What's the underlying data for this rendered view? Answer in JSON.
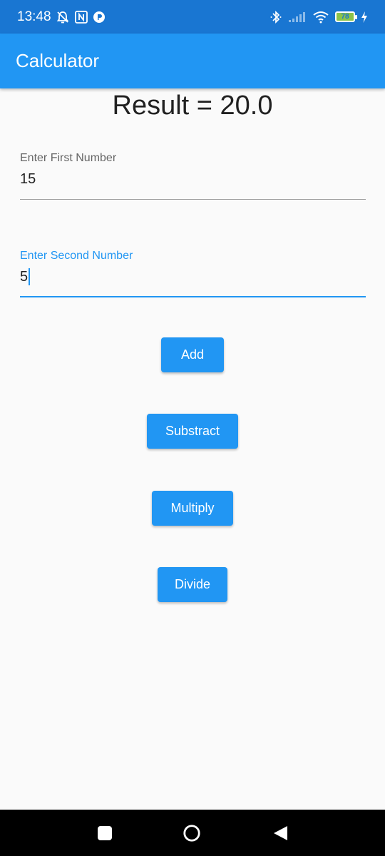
{
  "status_bar": {
    "time": "13:48",
    "battery": "78",
    "icons": [
      "mute-bell-icon",
      "nfc-icon",
      "app-notification-icon",
      "bluetooth-icon",
      "signal-icon",
      "wifi-icon",
      "battery-icon",
      "charging-icon"
    ]
  },
  "app_bar": {
    "title": "Calculator"
  },
  "result": {
    "text": "Result = 20.0"
  },
  "inputs": {
    "first": {
      "label": "Enter First Number",
      "value": "15"
    },
    "second": {
      "label": "Enter Second Number",
      "value": "5"
    }
  },
  "buttons": {
    "add": "Add",
    "subtract": "Substract",
    "multiply": "Multiply",
    "divide": "Divide"
  },
  "nav_bar": {
    "icons": [
      "recents-icon",
      "home-icon",
      "back-icon"
    ]
  },
  "colors": {
    "primary": "#2196f3",
    "status_bar": "#1976d2",
    "background": "#fafafa"
  }
}
